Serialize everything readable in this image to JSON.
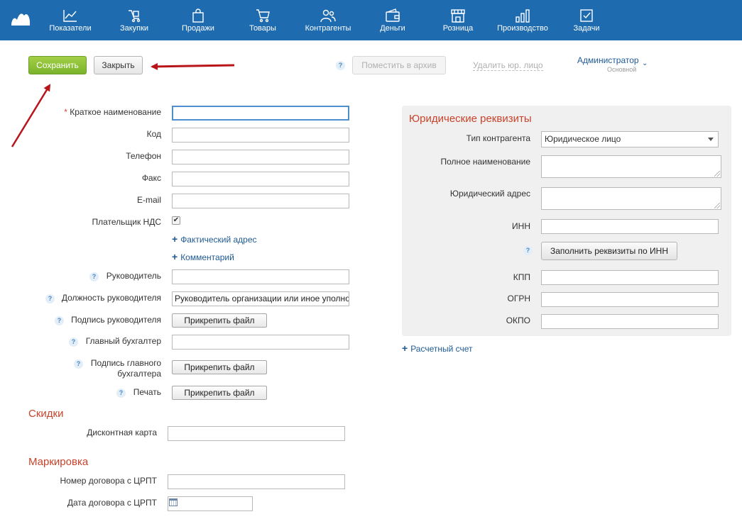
{
  "nav": {
    "items": [
      {
        "label": "Показатели",
        "icon": "chart-icon"
      },
      {
        "label": "Закупки",
        "icon": "purchases-icon"
      },
      {
        "label": "Продажи",
        "icon": "bag-icon"
      },
      {
        "label": "Товары",
        "icon": "cart-icon"
      },
      {
        "label": "Контрагенты",
        "icon": "contacts-icon"
      },
      {
        "label": "Деньги",
        "icon": "wallet-icon"
      },
      {
        "label": "Розница",
        "icon": "store-icon"
      },
      {
        "label": "Производство",
        "icon": "production-icon"
      },
      {
        "label": "Задачи",
        "icon": "tasks-icon"
      }
    ]
  },
  "toolbar": {
    "save_label": "Сохранить",
    "close_label": "Закрыть",
    "help_mark": "?",
    "archive_label": "Поместить в архив",
    "delete_label": "Удалить юр. лицо",
    "user_name": "Администратор",
    "user_role": "Основной",
    "user_chevron": "⌄"
  },
  "form": {
    "required_mark": "*",
    "short_name_label": "Краткое наименование",
    "short_name_value": "",
    "code_label": "Код",
    "phone_label": "Телефон",
    "fax_label": "Факс",
    "email_label": "E-mail",
    "vat_label": "Плательщик НДС",
    "vat_checked": true,
    "check_mark": "✔",
    "plus_mark": "+",
    "actual_address_label": "Фактический адрес",
    "comment_label": "Комментарий",
    "director_label": "Руководитель",
    "director_position_label": "Должность руководителя",
    "director_position_value": "Руководитель организации или иное уполно",
    "director_signature_label": "Подпись руководителя",
    "attach_file_label": "Прикрепить файл",
    "chief_accountant_label": "Главный бухгалтер",
    "chief_accountant_signature_label_1": "Подпись главного",
    "chief_accountant_signature_label_2": "бухгалтера",
    "stamp_label": "Печать"
  },
  "discounts": {
    "title": "Скидки",
    "card_label": "Дисконтная карта"
  },
  "marking": {
    "title": "Маркировка",
    "contract_number_label": "Номер договора с ЦРПТ",
    "contract_date_label": "Дата договора с ЦРПТ"
  },
  "legal": {
    "title": "Юридические реквизиты",
    "type_label": "Тип контрагента",
    "type_value": "Юридическое лицо",
    "full_name_label": "Полное наименование",
    "legal_address_label": "Юридический адрес",
    "inn_label": "ИНН",
    "fill_by_inn_label": "Заполнить реквизиты по ИНН",
    "kpp_label": "КПП",
    "ogrn_label": "ОГРН",
    "okpo_label": "ОКПО",
    "account_label": "Расчетный счет"
  },
  "colors": {
    "nav_bg": "#1e6bb0",
    "save_green": "#8cc03a",
    "section_red": "#c9432b",
    "link_blue": "#1e5a94",
    "annotation_arrow": "#b8151b"
  }
}
